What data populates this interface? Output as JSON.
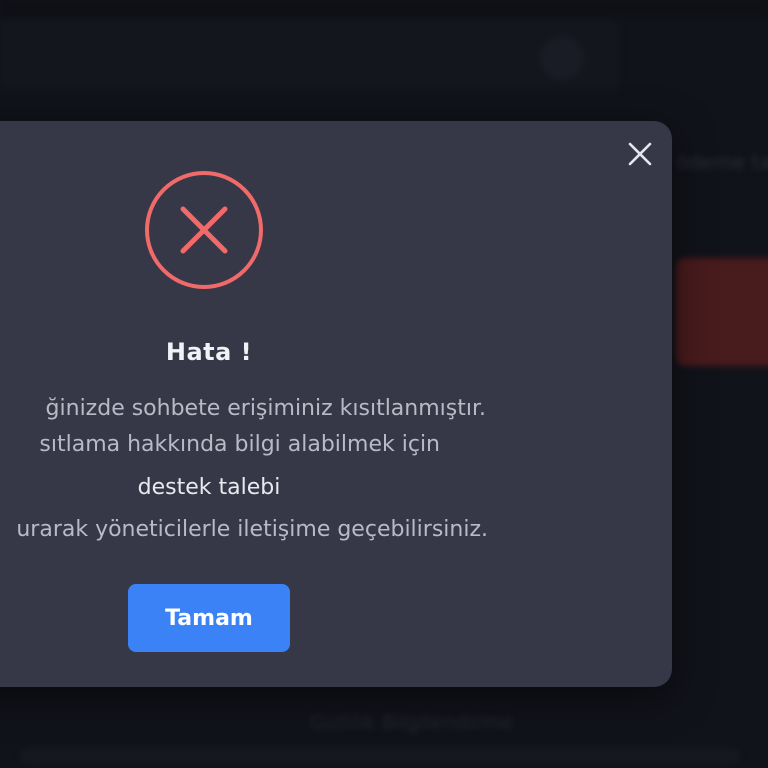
{
  "background": {
    "side_text": "ödeme talep",
    "footer_text": "Gizlilik Bilgilendirme"
  },
  "modal": {
    "title": "Hata !",
    "message_line_1": "ğinizde sohbete erişiminiz kısıtlanmıştır.",
    "message_line_2": "sıtlama hakkında bilgi alabilmek için",
    "support_link": "destek talebi",
    "message_line_3": "urarak yöneticilerle iletişime geçebilirsiniz.",
    "ok_button": "Tamam",
    "icons": {
      "close": "close-icon",
      "error": "error-circle-x-icon"
    }
  },
  "colors": {
    "modal_bg": "#363847",
    "error_red": "#f06a6a",
    "button_blue": "#3b82f6",
    "accent_red_bg": "#6b2424"
  }
}
